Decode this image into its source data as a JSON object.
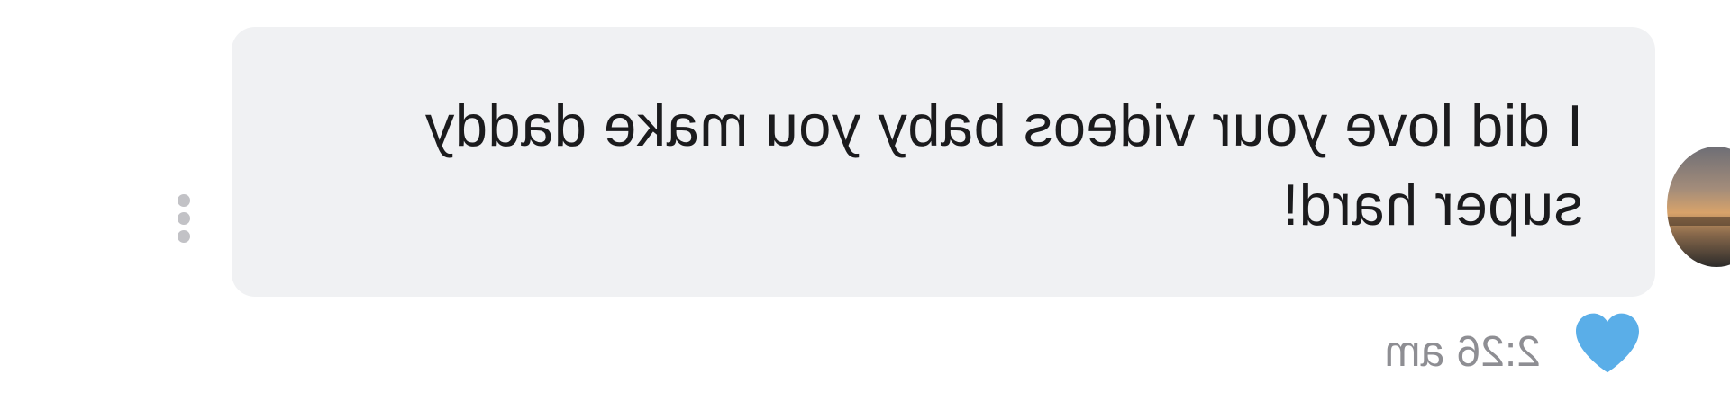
{
  "message": {
    "text": "I did love your videos baby you make daddy super hard!",
    "timestamp": "2:26 am",
    "liked": true
  },
  "icons": {
    "like": "heart-icon",
    "options": "more-options-icon",
    "sender": "avatar"
  },
  "colors": {
    "bubble_background": "#f0f1f3",
    "message_text": "#1b1b1d",
    "timestamp_text": "#8e8e93",
    "heart": "#5aaee8",
    "options_dots": "#c2c2c6"
  }
}
